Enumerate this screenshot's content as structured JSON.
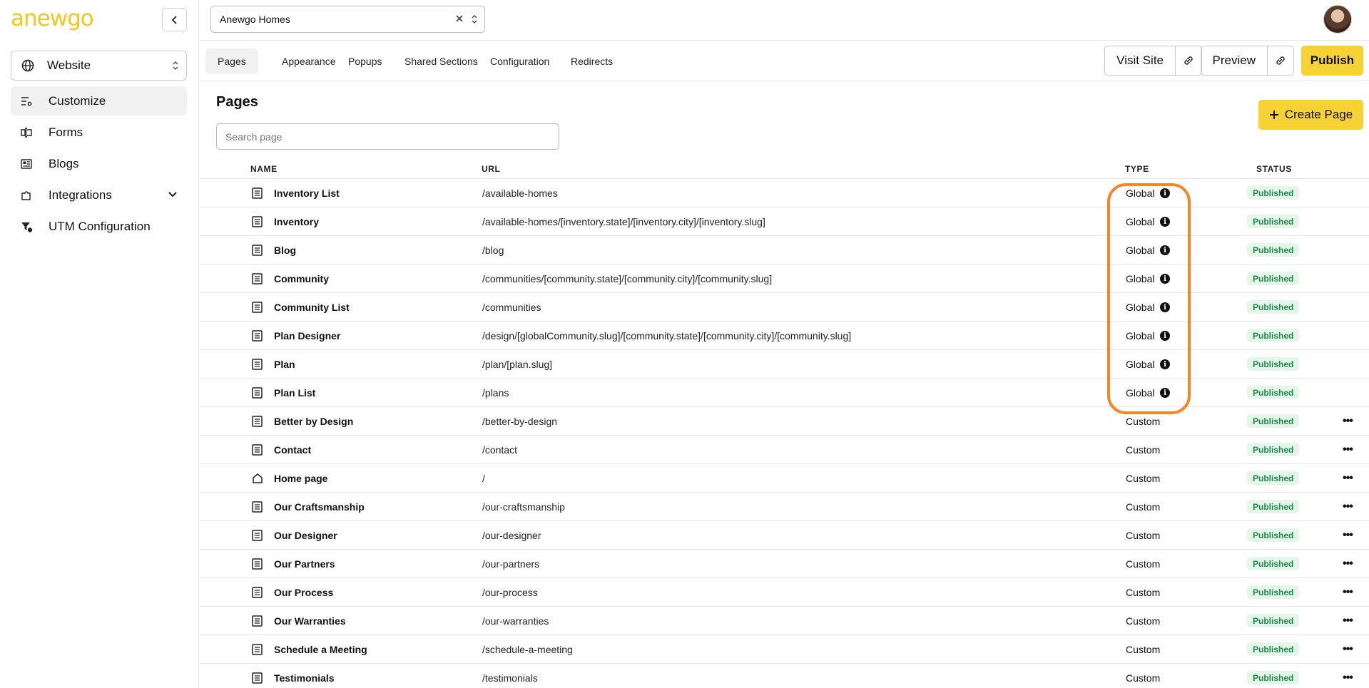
{
  "brand": {
    "logo_text_a": "a",
    "logo_text_rest": "newgo",
    "accent": "#f6d234",
    "highlight_color": "#f6852a"
  },
  "sidebar": {
    "site_selector": "Website",
    "items": [
      {
        "label": "Customize",
        "icon": "sliders-icon",
        "active": true
      },
      {
        "label": "Forms",
        "icon": "form-icon"
      },
      {
        "label": "Blogs",
        "icon": "newspaper-icon"
      },
      {
        "label": "Integrations",
        "icon": "puzzle-icon",
        "expandable": true
      },
      {
        "label": "UTM Configuration",
        "icon": "filter-dollar-icon"
      }
    ]
  },
  "header": {
    "builder_select": "Anewgo Homes"
  },
  "tabs": [
    {
      "label": "Pages",
      "active": true
    },
    {
      "label": "Appearance"
    },
    {
      "label": "Popups"
    },
    {
      "label": "Shared Sections"
    },
    {
      "label": "Configuration"
    },
    {
      "label": "Redirects"
    }
  ],
  "actions": {
    "visit_site": "Visit Site",
    "preview": "Preview",
    "publish": "Publish"
  },
  "main": {
    "title": "Pages",
    "create_label": "Create Page",
    "search_placeholder": "Search page",
    "columns": {
      "name": "NAME",
      "url": "URL",
      "type": "TYPE",
      "status": "STATUS"
    },
    "rows": [
      {
        "name": "Inventory List",
        "url": "/available-homes",
        "type": "Global",
        "status": "Published"
      },
      {
        "name": "Inventory",
        "url": "/available-homes/[inventory.state]/[inventory.city]/[inventory.slug]",
        "type": "Global",
        "status": "Published"
      },
      {
        "name": "Blog",
        "url": "/blog",
        "type": "Global",
        "status": "Published"
      },
      {
        "name": "Community",
        "url": "/communities/[community.state]/[community.city]/[community.slug]",
        "type": "Global",
        "status": "Published"
      },
      {
        "name": "Community List",
        "url": "/communities",
        "type": "Global",
        "status": "Published"
      },
      {
        "name": "Plan Designer",
        "url": "/design/[globalCommunity.slug]/[community.state]/[community.city]/[community.slug]",
        "type": "Global",
        "status": "Published"
      },
      {
        "name": "Plan",
        "url": "/plan/[plan.slug]",
        "type": "Global",
        "status": "Published"
      },
      {
        "name": "Plan List",
        "url": "/plans",
        "type": "Global",
        "status": "Published"
      },
      {
        "name": "Better by Design",
        "url": "/better-by-design",
        "type": "Custom",
        "status": "Published"
      },
      {
        "name": "Contact",
        "url": "/contact",
        "type": "Custom",
        "status": "Published"
      },
      {
        "name": "Home page",
        "url": "/",
        "type": "Custom",
        "status": "Published",
        "home": true
      },
      {
        "name": "Our Craftsmanship",
        "url": "/our-craftsmanship",
        "type": "Custom",
        "status": "Published"
      },
      {
        "name": "Our Designer",
        "url": "/our-designer",
        "type": "Custom",
        "status": "Published"
      },
      {
        "name": "Our Partners",
        "url": "/our-partners",
        "type": "Custom",
        "status": "Published"
      },
      {
        "name": "Our Process",
        "url": "/our-process",
        "type": "Custom",
        "status": "Published"
      },
      {
        "name": "Our Warranties",
        "url": "/our-warranties",
        "type": "Custom",
        "status": "Published"
      },
      {
        "name": "Schedule a Meeting",
        "url": "/schedule-a-meeting",
        "type": "Custom",
        "status": "Published"
      },
      {
        "name": "Testimonials",
        "url": "/testimonials",
        "type": "Custom",
        "status": "Published"
      }
    ]
  }
}
